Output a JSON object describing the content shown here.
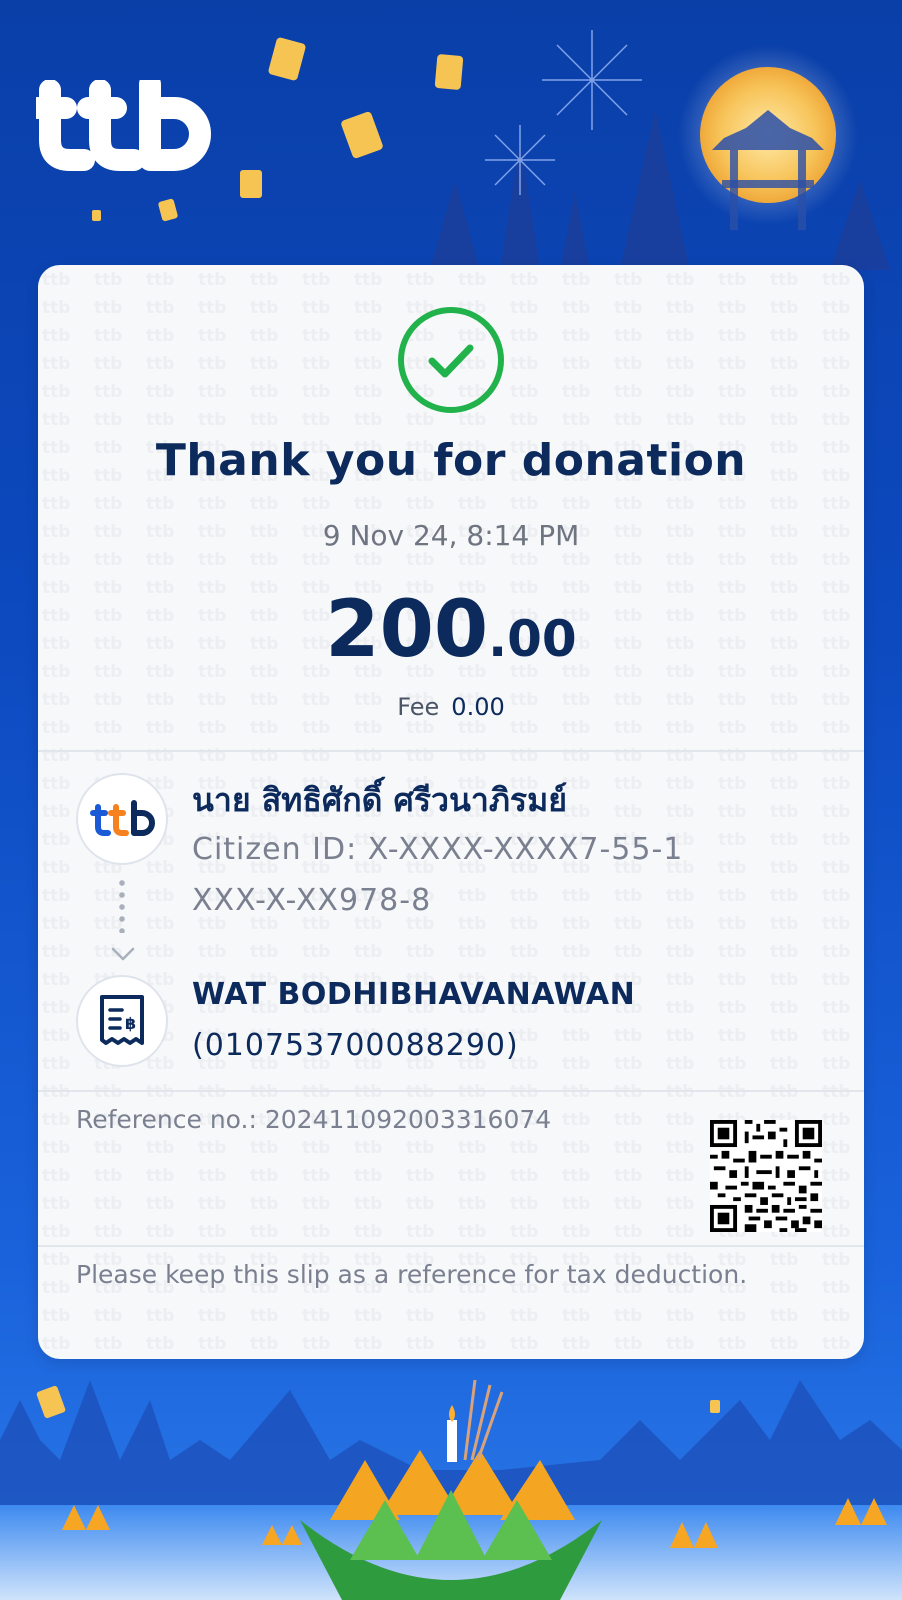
{
  "brand": {
    "logo_text": "ttb",
    "logo_icon": "ttb-logo"
  },
  "receipt": {
    "status_icon": "check-circle-icon",
    "title": "Thank you for donation",
    "datetime": "9 Nov 24, 8:14 PM",
    "amount_integer": "200",
    "amount_decimal": ".00",
    "fee_label": "Fee",
    "fee_value": "0.00"
  },
  "sender": {
    "bank_icon": "ttb-bank-icon",
    "name": "นาย สิทธิศักดิ์ ศรีวนาภิรมย์",
    "citizen_id": "Citizen ID: X-XXXX-XXXX7-55-1",
    "account": "XXX-X-XX978-8"
  },
  "recipient": {
    "icon": "donation-receipt-icon",
    "name": "WAT BODHIBHAVANAWAN",
    "id": "(010753700088290)"
  },
  "reference": {
    "label": "Reference no.: 20241109200331607​4",
    "qr_icon": "qr-code-icon"
  },
  "note": "Please keep this slip as a reference for tax deduction.",
  "colors": {
    "background": "#0d4ac0",
    "navy_text": "#0c2a5c",
    "success_green": "#22b24c",
    "brand_orange": "#f5821f",
    "brand_blue": "#1a5ad6"
  }
}
